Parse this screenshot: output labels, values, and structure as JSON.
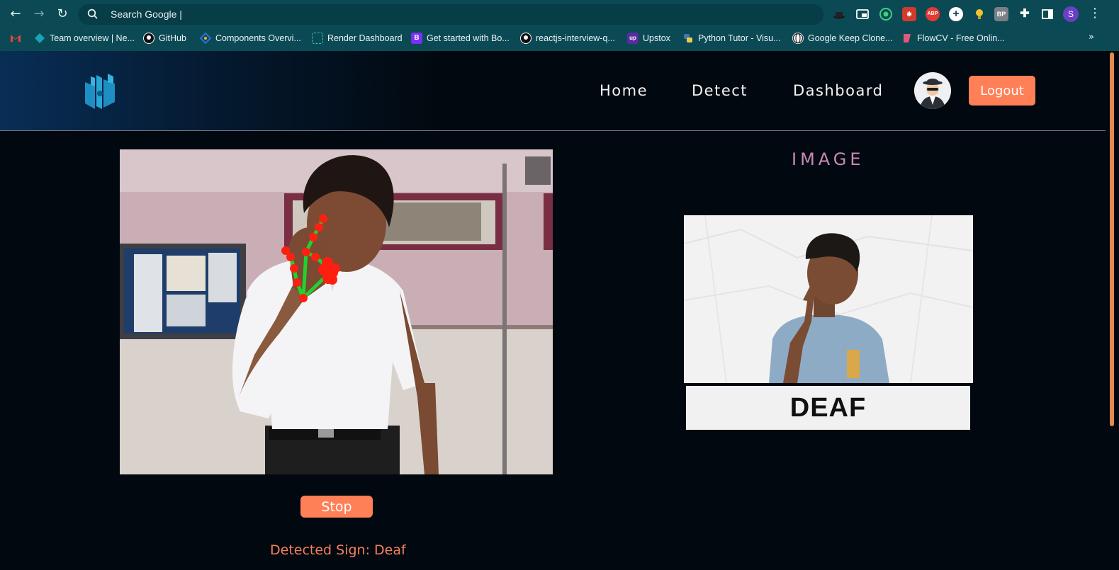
{
  "browser": {
    "omnibox": {
      "text": "Search Google |"
    },
    "extensions": [
      "hat-icon",
      "pip-icon",
      "target-icon",
      "pixel-icon",
      "abp-icon",
      "plus-icon",
      "bulb-icon",
      "bp-icon",
      "puzzle-icon",
      "sidepanel-icon"
    ],
    "extension_labels": {
      "abp": "ABP",
      "bp": "BP"
    },
    "profile_initial": "S",
    "bookmarks": [
      {
        "label": "",
        "icon": "gmail-icon",
        "color": "#d94a3d"
      },
      {
        "label": "Team overview | Ne...",
        "icon": "diamond-icon",
        "color": "#18a3b8"
      },
      {
        "label": "GitHub",
        "icon": "github-icon",
        "color": "#ffffff"
      },
      {
        "label": "Components Overvi...",
        "icon": "components-icon",
        "color": "#2f6fd6"
      },
      {
        "label": "Render Dashboard",
        "icon": "render-icon",
        "color": "#3cc6b2"
      },
      {
        "label": "Get started with Bo...",
        "icon": "bootstrap-icon",
        "color": "#7b2ff2",
        "glyph": "B"
      },
      {
        "label": "reactjs-interview-q...",
        "icon": "github-icon",
        "color": "#ffffff"
      },
      {
        "label": "Upstox",
        "icon": "upstox-icon",
        "color": "#5a2ca0",
        "glyph": "up"
      },
      {
        "label": "Python Tutor - Visu...",
        "icon": "python-icon",
        "color": "#3d77b4"
      },
      {
        "label": "Google Keep Clone...",
        "icon": "globe-icon",
        "color": "#ffffff"
      },
      {
        "label": "FlowCV - Free Onlin...",
        "icon": "flowcv-icon",
        "color": "#e4577c"
      }
    ],
    "more_bookmarks": "»"
  },
  "nav": {
    "links": [
      "Home",
      "Detect",
      "Dashboard"
    ],
    "logout": "Logout"
  },
  "detection": {
    "stop_label": "Stop",
    "result_text": "Detected Sign: Deaf"
  },
  "reference": {
    "title": "IMAGE",
    "caption": "DEAF"
  },
  "colors": {
    "accent": "#ff7f57",
    "title_pink": "#c88ab6",
    "background": "#02080f",
    "chrome": "#0b4a55"
  }
}
